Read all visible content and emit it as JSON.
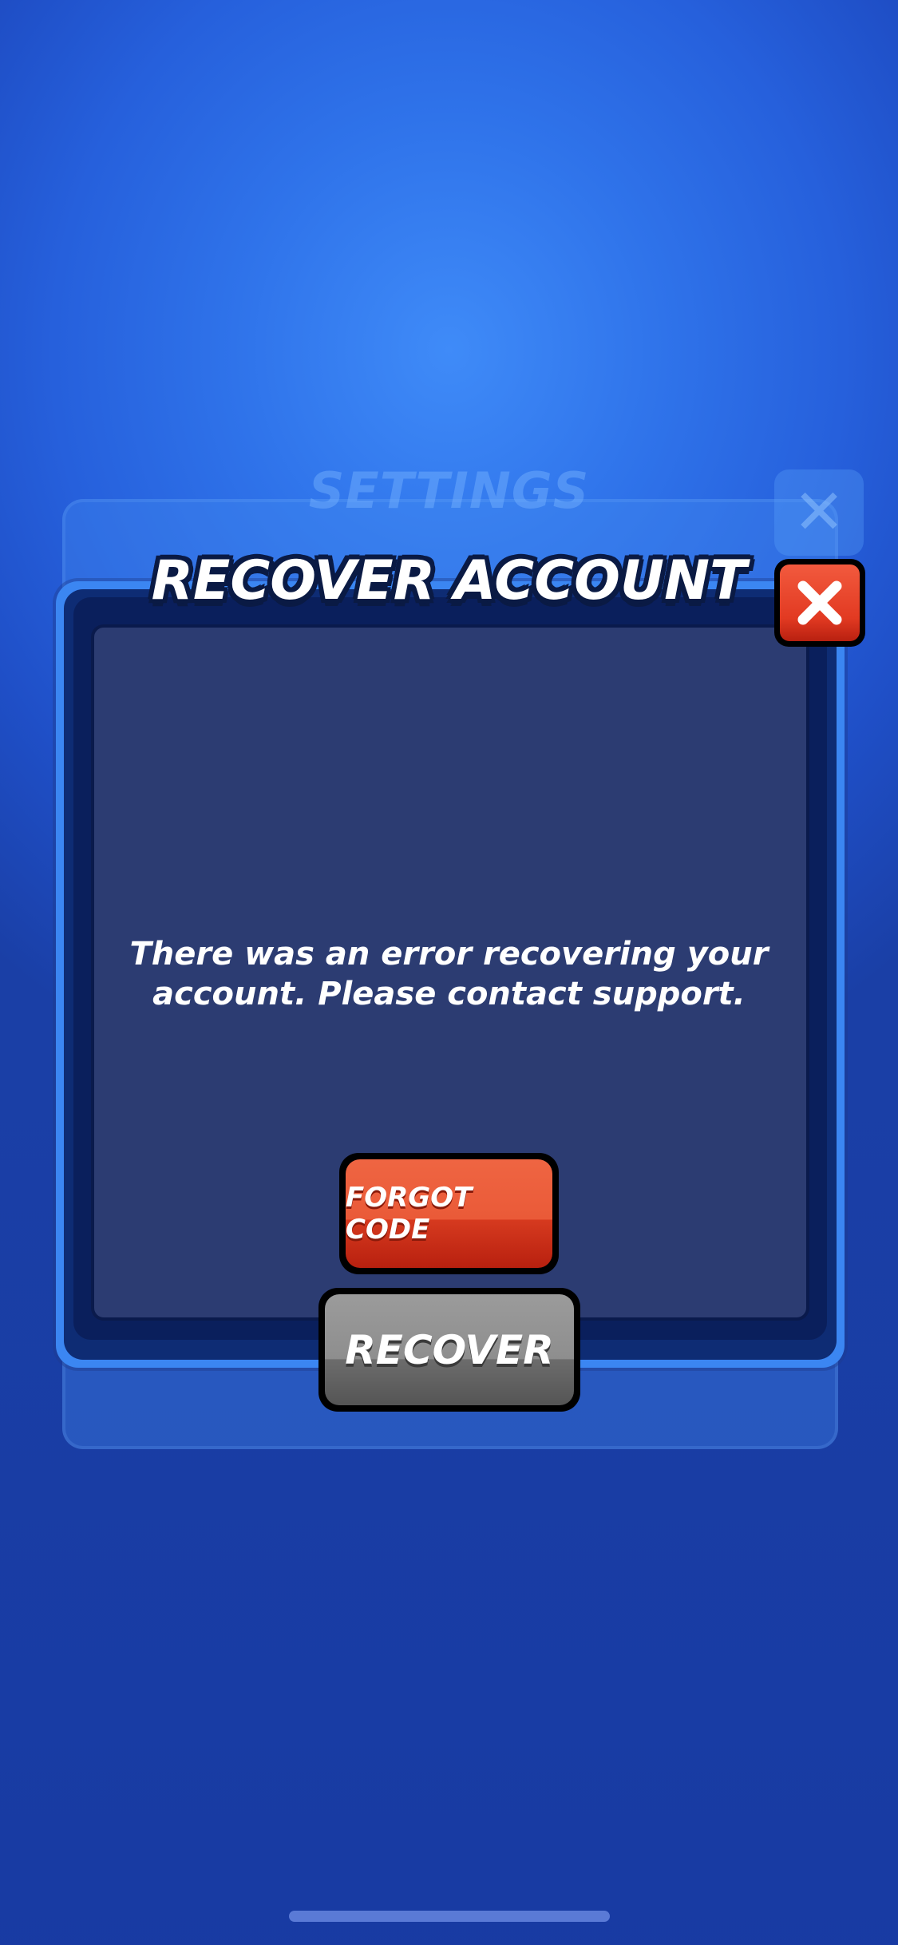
{
  "background": {
    "settings_title": "SETTINGS",
    "ghost_close_glyph": "✕"
  },
  "modal": {
    "title": "RECOVER ACCOUNT",
    "message": "There was an error recovering your account. Please contact support.",
    "close_icon": "close-x-icon",
    "forgot_code_label": "FORGOT CODE",
    "recover_label": "RECOVER"
  },
  "colors": {
    "background_blue": "#2f73ea",
    "panel": "#2c3c72",
    "forgot_button": "#ea5a38",
    "recover_button": "#8e8e8e",
    "close_button": "#e23a22"
  }
}
